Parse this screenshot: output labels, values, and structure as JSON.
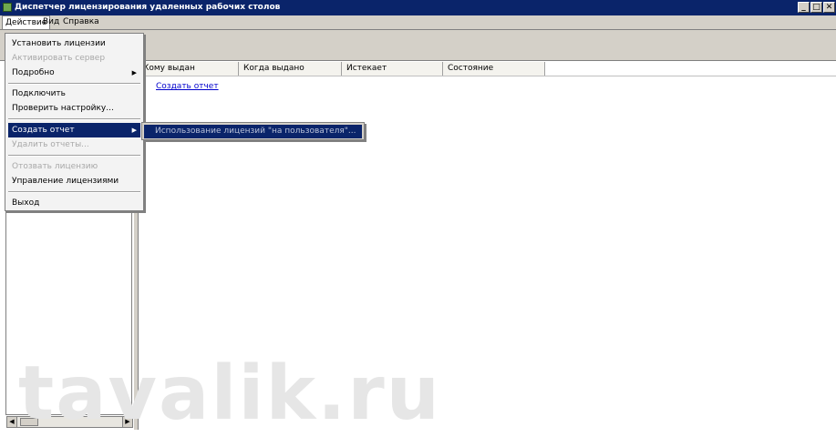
{
  "window": {
    "title": "Диспетчер лицензирования удаленных рабочих столов",
    "buttons": {
      "minimize": "_",
      "maximize": "□",
      "close": "✕"
    }
  },
  "menubar": {
    "items": [
      "Действие",
      "Вид",
      "Справка"
    ]
  },
  "table": {
    "columns": [
      "Кому выдан",
      "Когда выдано",
      "Истекает",
      "Состояние"
    ],
    "link": "Создать отчет"
  },
  "action_menu": {
    "items": [
      {
        "label": "Установить лицензии",
        "disabled": false
      },
      {
        "label": "Активировать сервер",
        "disabled": true
      },
      {
        "label": "Подробно",
        "disabled": false,
        "submenu": true
      },
      {
        "label": "Подключить",
        "disabled": false
      },
      {
        "label": "Проверить настройку...",
        "disabled": false
      },
      {
        "label": "Создать отчет",
        "disabled": false,
        "submenu": true,
        "highlighted": true
      },
      {
        "label": "Удалить отчеты...",
        "disabled": true
      },
      {
        "label": "Отозвать лицензию",
        "disabled": true
      },
      {
        "label": "Управление лицензиями",
        "disabled": false
      },
      {
        "label": "Выход",
        "disabled": false
      }
    ]
  },
  "submenu": {
    "item": "Использование лицензий \"на пользователя\"..."
  },
  "watermark": "tavalik.ru",
  "colors": {
    "titlebar": "#0a246a",
    "highlight": "#0a246a",
    "link": "#0000cc"
  }
}
